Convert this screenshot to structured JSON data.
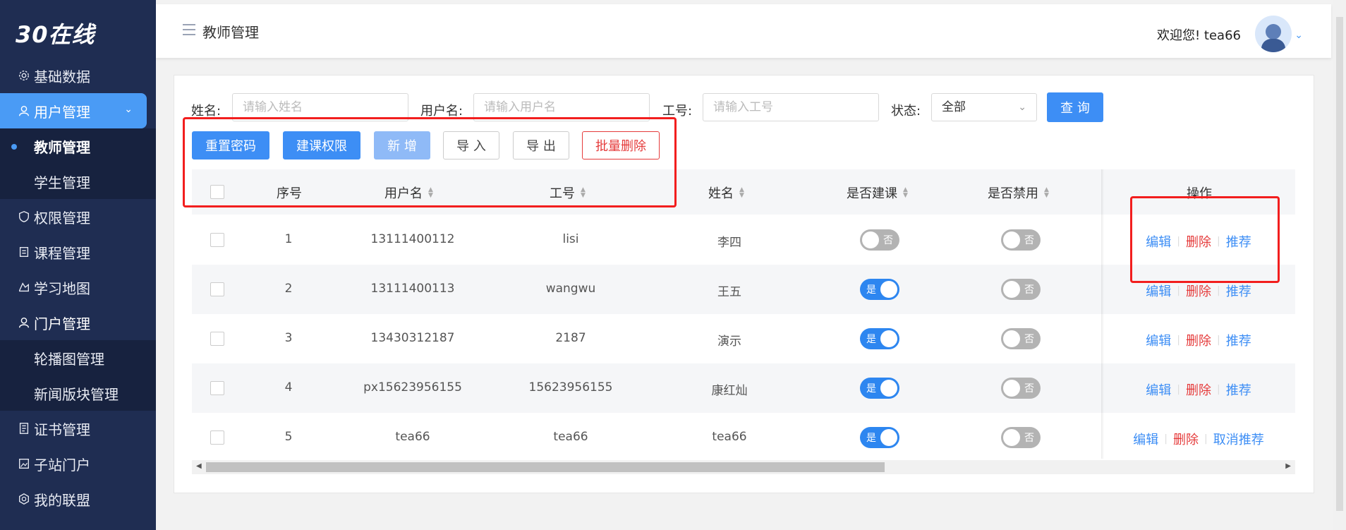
{
  "sidebar": {
    "logo": "30在线",
    "items": [
      {
        "label": "基础数据",
        "icon": "gear-icon"
      },
      {
        "label": "用户管理",
        "icon": "user-icon"
      },
      {
        "label": "教师管理"
      },
      {
        "label": "学生管理"
      },
      {
        "label": "权限管理",
        "icon": "shield-icon"
      },
      {
        "label": "课程管理",
        "icon": "document-icon"
      },
      {
        "label": "学习地图",
        "icon": "map-icon"
      },
      {
        "label": "门户管理",
        "icon": "user-icon"
      },
      {
        "label": "轮播图管理"
      },
      {
        "label": "新闻版块管理"
      },
      {
        "label": "证书管理",
        "icon": "certificate-icon"
      },
      {
        "label": "子站门户",
        "icon": "image-icon"
      },
      {
        "label": "我的联盟",
        "icon": "alliance-icon"
      }
    ]
  },
  "header": {
    "title": "教师管理",
    "welcome": "欢迎您!  tea66"
  },
  "filters": {
    "name_label": "姓名:",
    "name_placeholder": "请输入姓名",
    "username_label": "用户名:",
    "username_placeholder": "请输入用户名",
    "jobno_label": "工号:",
    "jobno_placeholder": "请输入工号",
    "status_label": "状态:",
    "status_value": "全部",
    "query_label": "查 询"
  },
  "toolbar": {
    "reset_password": "重置密码",
    "course_permission": "建课权限",
    "add": "新 增",
    "import": "导 入",
    "export": "导 出",
    "batch_delete": "批量删除"
  },
  "table": {
    "headers": [
      "序号",
      "用户名",
      "工号",
      "姓名",
      "是否建课",
      "是否禁用",
      "操作"
    ],
    "rows": [
      {
        "no": "1",
        "username": "13111400112",
        "jobno": "lisi",
        "name": "李四",
        "course": "否",
        "disabled": "否",
        "ops": [
          "编辑",
          "删除",
          "推荐"
        ]
      },
      {
        "no": "2",
        "username": "13111400113",
        "jobno": "wangwu",
        "name": "王五",
        "course": "是",
        "disabled": "否",
        "ops": [
          "编辑",
          "删除",
          "推荐"
        ]
      },
      {
        "no": "3",
        "username": "13430312187",
        "jobno": "2187",
        "name": "演示",
        "course": "是",
        "disabled": "否",
        "ops": [
          "编辑",
          "删除",
          "推荐"
        ]
      },
      {
        "no": "4",
        "username": "px15623956155",
        "jobno": "15623956155",
        "name": "康红灿",
        "course": "是",
        "disabled": "否",
        "ops": [
          "编辑",
          "删除",
          "推荐"
        ]
      },
      {
        "no": "5",
        "username": "tea66",
        "jobno": "tea66",
        "name": "tea66",
        "course": "是",
        "disabled": "否",
        "ops": [
          "编辑",
          "删除",
          "取消推荐"
        ]
      }
    ]
  },
  "colors": {
    "sidebar_bg": "#1f2d52",
    "accent": "#3d8ef5",
    "danger": "#e53b3b",
    "annotation": "#f21e1e"
  }
}
